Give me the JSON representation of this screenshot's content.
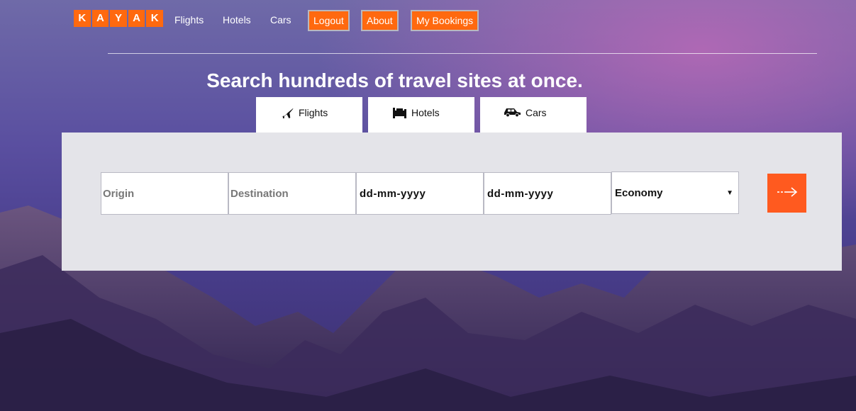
{
  "brand": {
    "logo_letters": [
      "K",
      "A",
      "Y",
      "A",
      "K"
    ],
    "accent": "#ff690f"
  },
  "nav": {
    "links": [
      "Flights",
      "Hotels",
      "Cars"
    ],
    "buttons": [
      "Logout",
      "About",
      "My Bookings"
    ]
  },
  "hero": {
    "headline": "Search hundreds of travel sites at once."
  },
  "tabs": [
    {
      "label": "Flights",
      "icon": "plane-icon"
    },
    {
      "label": "Hotels",
      "icon": "bed-icon"
    },
    {
      "label": "Cars",
      "icon": "car-icon"
    }
  ],
  "search": {
    "origin_placeholder": "Origin",
    "destination_placeholder": "Destination",
    "depart_date": "dd-mm-yyyy",
    "return_date": "dd-mm-yyyy",
    "cabin_class": "Economy",
    "submit_icon": "arrow-right-icon"
  }
}
